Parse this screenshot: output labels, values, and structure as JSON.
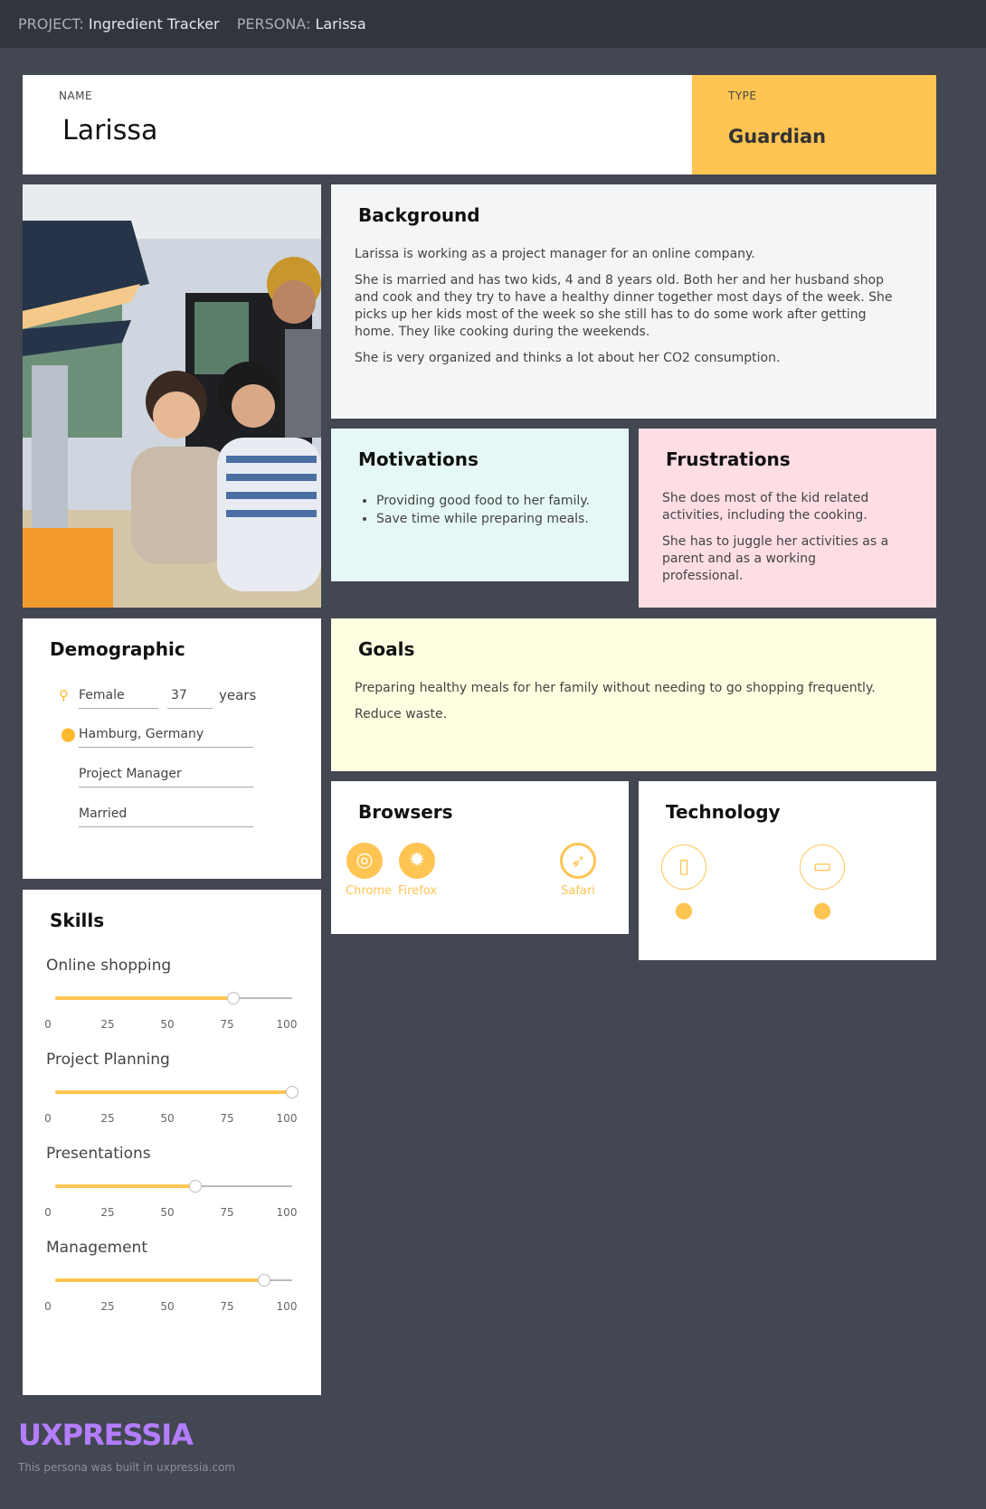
{
  "topbar": {
    "project_key": "PROJECT:",
    "project_value": "Ingredient Tracker",
    "persona_key": "PERSONA:",
    "persona_value": "Larissa"
  },
  "name_card": {
    "label": "NAME",
    "value": "Larissa"
  },
  "type_card": {
    "label": "TYPE",
    "value": "Guardian"
  },
  "background": {
    "title": "Background",
    "paragraphs": [
      "Larissa is working as a project manager for an online company.",
      "She is married and has two kids, 4 and 8 years old. Both her and her husband shop and cook and they try to have a healthy dinner together most days of the week. She picks up her kids most of the week so she still has to do some work after getting home. They like cooking during the weekends.",
      "She is very organized and thinks a lot about her CO2 consumption."
    ]
  },
  "motivations": {
    "title": "Motivations",
    "items": [
      "Providing good food to her family.",
      "Save time while preparing meals."
    ]
  },
  "frustrations": {
    "title": "Frustrations",
    "paragraphs": [
      "She does most of the kid related activities, including the cooking.",
      "She has to juggle her activities as a parent and as a working professional."
    ]
  },
  "demographic": {
    "title": "Demographic",
    "gender": "Female",
    "age": "37",
    "age_unit": "years",
    "location": "Hamburg, Germany",
    "occupation": "Project Manager",
    "status": "Married"
  },
  "goals": {
    "title": "Goals",
    "paragraphs": [
      "Preparing healthy meals for her family without needing to go shopping frequently.",
      "Reduce waste."
    ]
  },
  "browsers": {
    "title": "Browsers",
    "items": [
      {
        "name": "Chrome",
        "icon": "chrome-icon"
      },
      {
        "name": "Firefox",
        "icon": "firefox-icon"
      },
      {
        "name": "Safari",
        "icon": "safari-icon"
      }
    ]
  },
  "technology": {
    "title": "Technology",
    "items": [
      {
        "device": "phone-icon",
        "os": "apple-icon"
      },
      {
        "device": "laptop-icon",
        "os": "apple-icon"
      }
    ]
  },
  "skills": {
    "title": "Skills",
    "scale": [
      "0",
      "25",
      "50",
      "75",
      "100"
    ],
    "items": [
      {
        "name": "Online shopping",
        "value": 75
      },
      {
        "name": "Project Planning",
        "value": 100
      },
      {
        "name": "Presentations",
        "value": 59
      },
      {
        "name": "Management",
        "value": 88
      }
    ]
  },
  "footer": {
    "logo": "UXPRESSIA",
    "built": "This persona was built in uxpressia.com"
  },
  "colors": {
    "accent": "#ffc452",
    "logo": "#b37dff",
    "background": "#434752"
  }
}
